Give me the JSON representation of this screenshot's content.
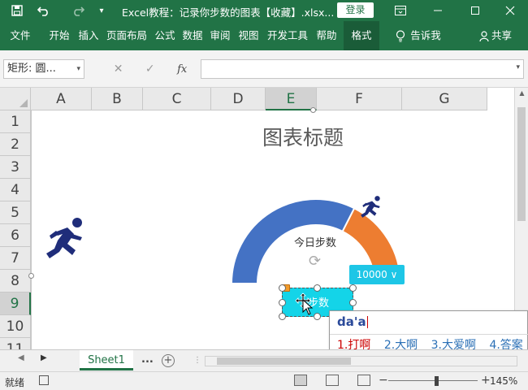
{
  "title_bar": {
    "title": "Excel教程：记录你步数的图表【收藏】.xlsx...",
    "login": "登录",
    "icons": [
      "save-icon",
      "undo-icon",
      "redo-icon",
      "customize-icon",
      "ribbon-display-icon",
      "minimize-icon",
      "maximize-icon",
      "close-icon"
    ]
  },
  "ribbon": {
    "tabs": [
      "文件",
      "开始",
      "插入",
      "页面布局",
      "公式",
      "数据",
      "审阅",
      "视图",
      "开发工具",
      "帮助",
      "格式"
    ],
    "active_tab": "格式",
    "tell_me": "告诉我",
    "share": "共享"
  },
  "formula_bar": {
    "name_box": "矩形: 圆...",
    "fx": "fx",
    "formula": ""
  },
  "columns": [
    "A",
    "B",
    "C",
    "D",
    "E",
    "F",
    "G"
  ],
  "rows": [
    "1",
    "2",
    "3",
    "4",
    "5",
    "6",
    "7",
    "8",
    "9",
    "10",
    "11"
  ],
  "chart": {
    "title": "图表标题",
    "gauge_label": "今日步数",
    "value_label": "10000 ∨",
    "shape_text": "步数",
    "gauge_fill_fraction": 0.65,
    "colors": {
      "fill": "#4472c4",
      "remain": "#ed7d31",
      "runner": "#1f2d7a",
      "chip": "#1ec6e6"
    }
  },
  "ime": {
    "typed": "da'a",
    "candidates": [
      "1.打啊",
      "2.大啊",
      "3.大爱啊",
      "4.答案"
    ]
  },
  "sheet_bar": {
    "sheet_name": "Sheet1",
    "more": "...",
    "add": "+"
  },
  "status_bar": {
    "ready": "就绪",
    "zoom": "145%"
  }
}
